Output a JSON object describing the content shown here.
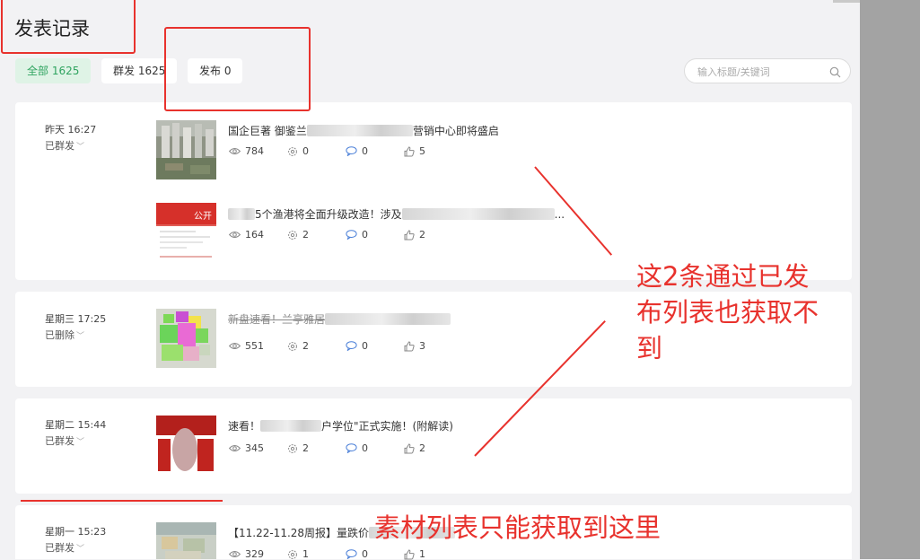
{
  "header": {
    "title": "发表记录"
  },
  "filters": [
    {
      "label": "全部 1625"
    },
    {
      "label": "群发 1625"
    },
    {
      "label": "发布 0"
    }
  ],
  "search": {
    "placeholder": "输入标题/关键词",
    "icon": "search-icon"
  },
  "records": [
    {
      "date": "昨天 16:27",
      "status": "已群发",
      "articles": [
        {
          "title_a": "国企巨著 御鉴兰",
          "title_b": "营销中心即将盛启",
          "views": "784",
          "shares": "0",
          "comments": "0",
          "likes": "5",
          "thumb_label": ""
        },
        {
          "title_a": "5个渔港将全面升级改造！涉及",
          "title_b": "...",
          "views": "164",
          "shares": "2",
          "comments": "0",
          "likes": "2",
          "thumb_label": "公开"
        }
      ]
    },
    {
      "date": "星期三 17:25",
      "status": "已删除",
      "articles": [
        {
          "title_a": "新盘速看！兰亭雅居",
          "title_b": "",
          "views": "551",
          "shares": "2",
          "comments": "0",
          "likes": "3"
        }
      ]
    },
    {
      "date": "星期二 15:44",
      "status": "已群发",
      "articles": [
        {
          "title_a": "速看！",
          "title_b": "户学位\"正式实施！(附解读)",
          "views": "345",
          "shares": "2",
          "comments": "0",
          "likes": "2"
        }
      ]
    },
    {
      "date": "星期一 15:23",
      "status": "已群发",
      "articles": [
        {
          "title_a": "【11.22-11.28周报】量跌价",
          "title_b": "",
          "views": "329",
          "shares": "1",
          "comments": "0",
          "likes": "1"
        }
      ]
    }
  ],
  "annotations": {
    "note_1": "这2条通过已发布列表也获取不到",
    "note_1_lines": [
      "这2条通过已发",
      "布列表也获取不",
      "到"
    ],
    "note_2": "素材列表只能获取到这里",
    "color": "#e8322d"
  },
  "colors": {
    "accent_green": "#2ea35f",
    "active_filter_bg": "#dff3e6",
    "page_bg": "#f2f2f4"
  }
}
